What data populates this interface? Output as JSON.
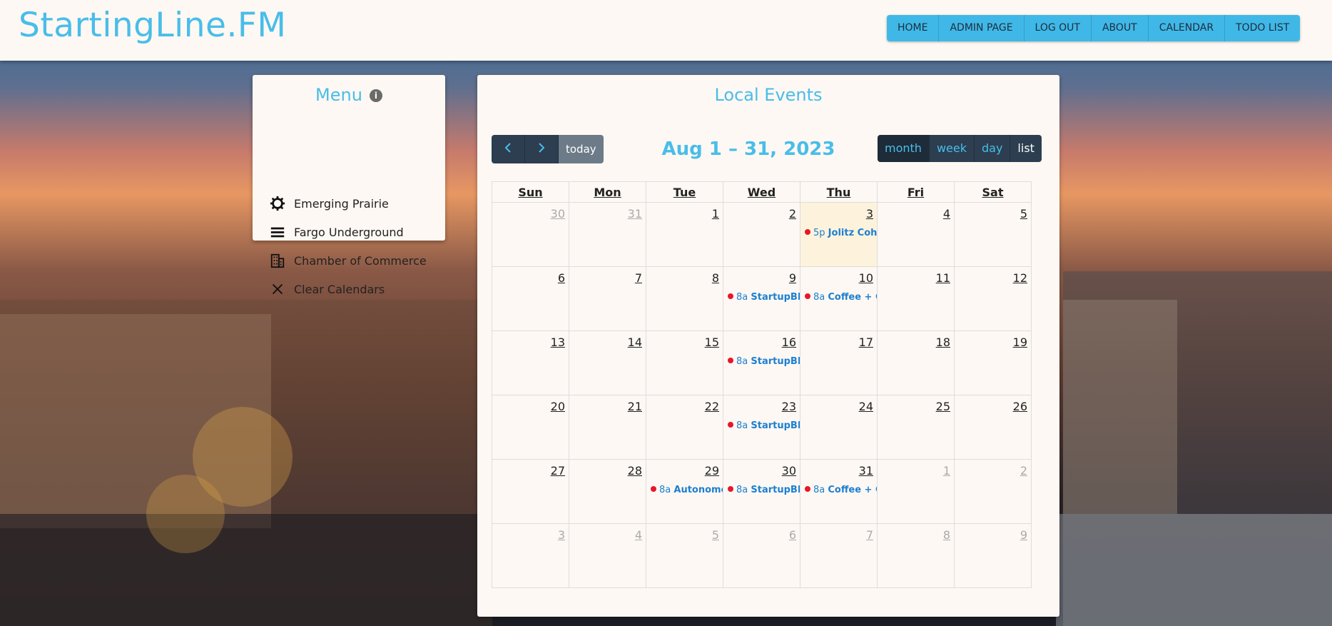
{
  "header": {
    "brand": "StartingLine.FM",
    "nav": [
      "HOME",
      "ADMIN PAGE",
      "LOG OUT",
      "ABOUT",
      "CALENDAR",
      "TODO LIST"
    ]
  },
  "menu": {
    "title": "Menu",
    "items": [
      {
        "label": "Emerging Prairie",
        "icon": "gear-icon"
      },
      {
        "label": "Fargo Underground",
        "icon": "layers-icon"
      },
      {
        "label": "Chamber of Commerce",
        "icon": "building-icon"
      },
      {
        "label": "Clear Calendars",
        "icon": "close-icon"
      }
    ]
  },
  "events": {
    "title": "Local Events",
    "today_label": "today",
    "range": "Aug 1 – 31, 2023",
    "views": [
      "month",
      "week",
      "day",
      "list"
    ],
    "weekdays": [
      "Sun",
      "Mon",
      "Tue",
      "Wed",
      "Thu",
      "Fri",
      "Sat"
    ],
    "weeks": [
      [
        {
          "n": "30",
          "o": true
        },
        {
          "n": "31",
          "o": true
        },
        {
          "n": "1"
        },
        {
          "n": "2"
        },
        {
          "n": "3",
          "today": true,
          "t": "5p",
          "e": "Jolitz Coh"
        },
        {
          "n": "4"
        },
        {
          "n": "5"
        }
      ],
      [
        {
          "n": "6"
        },
        {
          "n": "7"
        },
        {
          "n": "8"
        },
        {
          "n": "9",
          "t": "8a",
          "e": "StartupBR"
        },
        {
          "n": "10",
          "t": "8a",
          "e": "Coffee + C"
        },
        {
          "n": "11"
        },
        {
          "n": "12"
        }
      ],
      [
        {
          "n": "13"
        },
        {
          "n": "14"
        },
        {
          "n": "15"
        },
        {
          "n": "16",
          "t": "8a",
          "e": "StartupBR"
        },
        {
          "n": "17"
        },
        {
          "n": "18"
        },
        {
          "n": "19"
        }
      ],
      [
        {
          "n": "20"
        },
        {
          "n": "21"
        },
        {
          "n": "22"
        },
        {
          "n": "23",
          "t": "8a",
          "e": "StartupBR"
        },
        {
          "n": "24"
        },
        {
          "n": "25"
        },
        {
          "n": "26"
        }
      ],
      [
        {
          "n": "27"
        },
        {
          "n": "28"
        },
        {
          "n": "29",
          "t": "8a",
          "e": "Autonomo"
        },
        {
          "n": "30",
          "t": "8a",
          "e": "StartupBR"
        },
        {
          "n": "31",
          "t": "8a",
          "e": "Coffee + C"
        },
        {
          "n": "1",
          "o": true
        },
        {
          "n": "2",
          "o": true
        }
      ],
      [
        {
          "n": "3",
          "o": true
        },
        {
          "n": "4",
          "o": true
        },
        {
          "n": "5",
          "o": true
        },
        {
          "n": "6",
          "o": true
        },
        {
          "n": "7",
          "o": true
        },
        {
          "n": "8",
          "o": true
        },
        {
          "n": "9",
          "o": true
        }
      ]
    ]
  },
  "colors": {
    "accent": "#49bde9",
    "nav_bg": "#3fb8e8",
    "button_dark": "#2c3e50",
    "event_dot": "#e8162a",
    "today_bg": "#fdf3dc"
  }
}
